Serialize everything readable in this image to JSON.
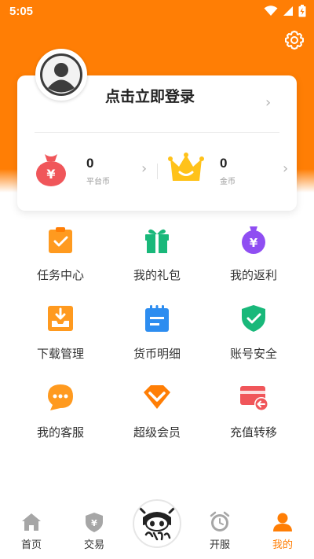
{
  "status_bar": {
    "time": "5:05"
  },
  "header": {
    "settings_icon": "gear-icon"
  },
  "profile": {
    "login_text": "点击立即登录",
    "platform_coin": {
      "value": "0",
      "label": "平台币"
    },
    "gold_coin": {
      "value": "0",
      "label": "金币"
    }
  },
  "grid": [
    {
      "label": "任务中心",
      "icon": "task-icon"
    },
    {
      "label": "我的礼包",
      "icon": "gift-icon"
    },
    {
      "label": "我的返利",
      "icon": "rebate-icon"
    },
    {
      "label": "下载管理",
      "icon": "download-icon"
    },
    {
      "label": "货币明细",
      "icon": "currency-icon"
    },
    {
      "label": "账号安全",
      "icon": "shield-icon"
    },
    {
      "label": "我的客服",
      "icon": "chat-icon"
    },
    {
      "label": "超级会员",
      "icon": "vip-icon"
    },
    {
      "label": "充值转移",
      "icon": "card-transfer-icon"
    }
  ],
  "tabs": [
    {
      "label": "首页",
      "icon": "home-icon",
      "active": false
    },
    {
      "label": "交易",
      "icon": "trade-icon",
      "active": false
    },
    {
      "label": "开服",
      "icon": "alarm-icon",
      "active": false
    },
    {
      "label": "我的",
      "icon": "user-icon",
      "active": true
    }
  ],
  "colors": {
    "accent": "#ff7e05",
    "green": "#19b87a",
    "blue": "#2d8df0",
    "purple": "#8f4ef2",
    "red": "#f0565a",
    "yellow": "#ffc21a",
    "tab_gray": "#9a9a9a"
  }
}
